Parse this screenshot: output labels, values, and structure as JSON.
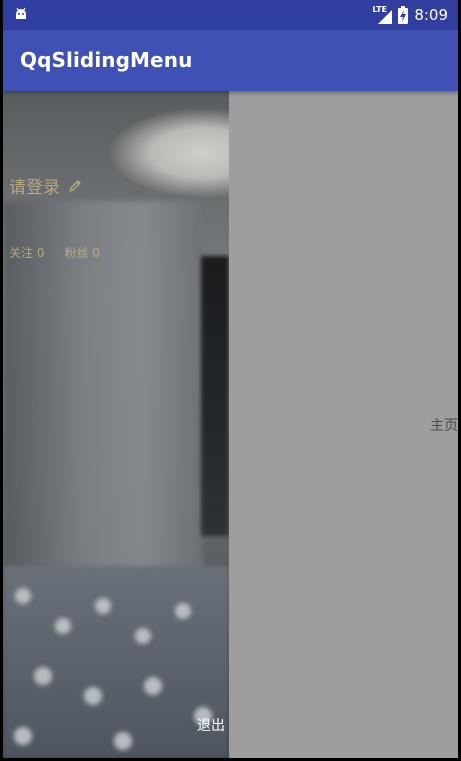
{
  "status_bar": {
    "time": "8:09",
    "network_label": "LTE",
    "icons": [
      "android-icon",
      "lte-signal-icon",
      "battery-charging-icon"
    ]
  },
  "app_bar": {
    "title": "QqSlidingMenu",
    "color": "#3F51B5",
    "status_color": "#303F9F"
  },
  "menu": {
    "login_label": "请登录",
    "edit_icon": "pencil-icon",
    "following_label": "关注 0",
    "followers_label": "粉丝 0",
    "logout_label": "退出",
    "text_color": "#B8A77E"
  },
  "content": {
    "main_label": "主页",
    "background": "#9E9E9E"
  }
}
